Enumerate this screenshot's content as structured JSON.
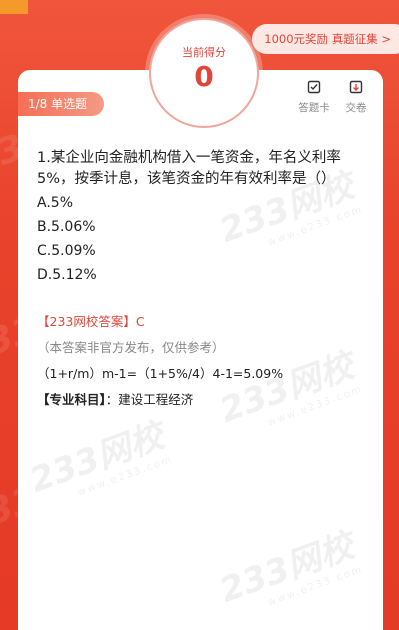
{
  "score": {
    "label": "当前得分",
    "value": "0"
  },
  "reward": {
    "label": "1000元奖励 真题征集 >"
  },
  "badge": {
    "label": "1/8 单选题"
  },
  "tools": {
    "card_label": "答题卡",
    "submit_label": "交卷"
  },
  "question": {
    "text": "1.某企业向金融机构借入一笔资金，年名义利率5%，按季计息，该笔资金的年有效利率是（）",
    "options": [
      "A.5%",
      "B.5.06%",
      "C.5.09%",
      "D.5.12%"
    ]
  },
  "answer": {
    "head": "【233网校答案】C",
    "note": "（本答案非官方发布，仅供参考）",
    "calc": "（1+r/m）m-1=（1+5%/4）4-1=5.09%",
    "subject_label": "【专业科目】",
    "subject_value": "：建设工程经济"
  },
  "watermark": {
    "main": "233网校",
    "sub": "www.e233.com"
  },
  "colors": {
    "accent": "#e0463a",
    "background": "#e8442e"
  }
}
